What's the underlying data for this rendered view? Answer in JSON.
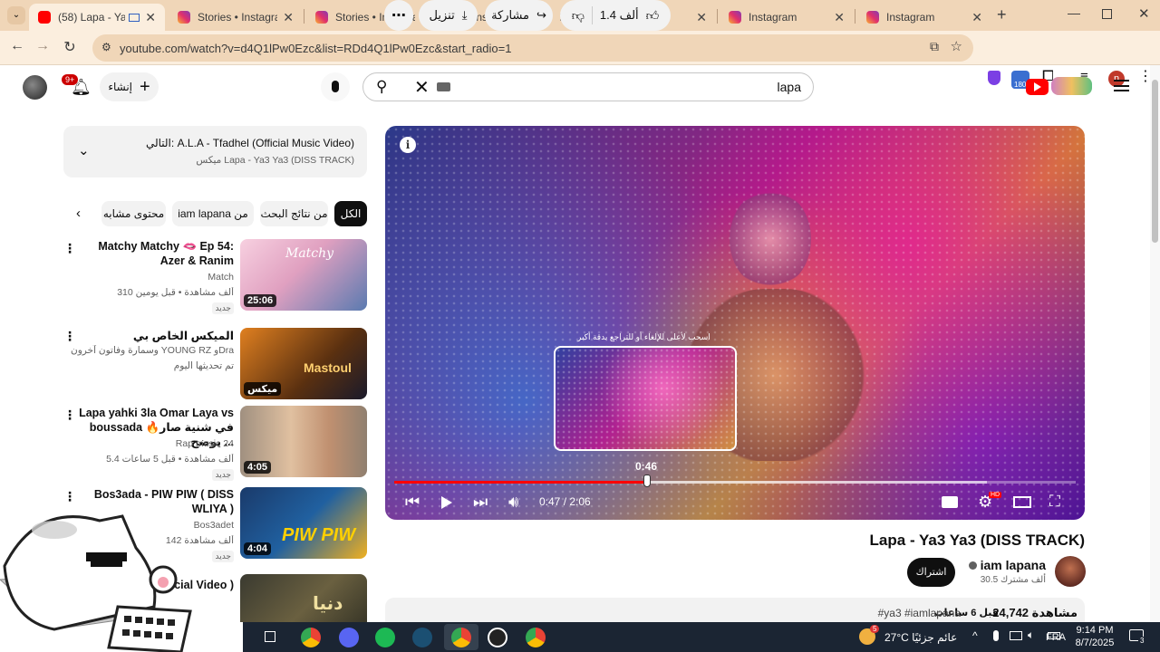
{
  "browser": {
    "tabs": [
      {
        "title": "(58) Lapa - Ya3 Ya",
        "icon": "youtube-icon",
        "active": true
      },
      {
        "title": "Stories • Instagram",
        "icon": "instagram-icon"
      },
      {
        "title": "Stories • Instagram",
        "icon": "instagram-icon"
      },
      {
        "title": "Instagram",
        "icon": "instagram-icon"
      },
      {
        "title": "Instagram",
        "icon": "instagram-icon"
      },
      {
        "title": "Instagram",
        "icon": "instagram-icon"
      },
      {
        "title": "Instagram",
        "icon": "instagram-icon"
      }
    ],
    "url": "youtube.com/watch?v=d4Q1lPw0Ezc&list=RDd4Q1lPw0Ezc&start_radio=1",
    "extension_badge": "180",
    "profile_initial": "n"
  },
  "header": {
    "notifications_count": "9+",
    "create_label": "إنشاء",
    "search_value": "lapa"
  },
  "up_next": {
    "title": "التالي: A.L.A - Tfadhel (Official Music Video)",
    "subtitle": "ميكس Lapa - Ya3 Ya3 (DISS TRACK)"
  },
  "chips": [
    {
      "label": "الكل",
      "selected": true
    },
    {
      "label": "من نتائج البحث"
    },
    {
      "label": "iam lapana من"
    },
    {
      "label": "محتوى مشابه"
    }
  ],
  "recommendations": [
    {
      "title": "Matchy Matchy 🫦 Ep 54: Azer & Ranim",
      "channel": "Match",
      "meta": "310 ألف مشاهدة • قبل يومين",
      "badge": "جديد",
      "duration": "25:06"
    },
    {
      "title": "الميكس الخاص بي",
      "channel": "وسمارة وفاتون آخرون YOUNG RZ وDraganov",
      "meta": "تم تحديثها اليوم",
      "badge": "",
      "duration": "ميكس"
    },
    {
      "title": "Lapa yahki 3la Omar Laya vs boussada في شنية صار🔥يوضح ...",
      "channel": "Rap music 24",
      "meta": "5.4 ألف مشاهدة • قبل 5 ساعات",
      "badge": "جديد",
      "duration": "4:05"
    },
    {
      "title": "Bos3ada - PIW PIW ( DISS WLIYA )",
      "channel": "Bos3adet",
      "meta": "142 ألف مشاهدة",
      "badge": "جديد",
      "duration": "4:04"
    },
    {
      "title": "ميكس ...icial Video )",
      "channel": "",
      "meta": "",
      "badge": "",
      "duration": ""
    }
  ],
  "player": {
    "preview_hint": "اسحب لأعلى للإلغاء أو للتراجع بدقة أكبر",
    "preview_time": "0:46",
    "time_current": "0:47",
    "time_total": "2:06",
    "time_display": "0:47 / 2:06",
    "progress_fraction": 0.373,
    "buffer_fraction": 0.87,
    "quality_badge": "HD"
  },
  "video": {
    "title": "Lapa - Ya3 Ya3 (DISS TRACK)",
    "channel": "iam lapana",
    "subscribers": "30.5 ألف مشترك",
    "subscribe_label": "اشتراك",
    "likes": "1.4 ألف",
    "share_label": "مشاركة",
    "download_label": "تنزيل",
    "views": "24,742 مشاهدة",
    "published": "قبل 6 ساعات",
    "hashtags": "#ya3 #iamlapana"
  },
  "taskbar": {
    "weather": "27°C عائم جزئيًا",
    "weather_badge": "5",
    "language": "FRA",
    "time": "9:14 PM",
    "date": "8/7/2025",
    "notifications": "3"
  }
}
